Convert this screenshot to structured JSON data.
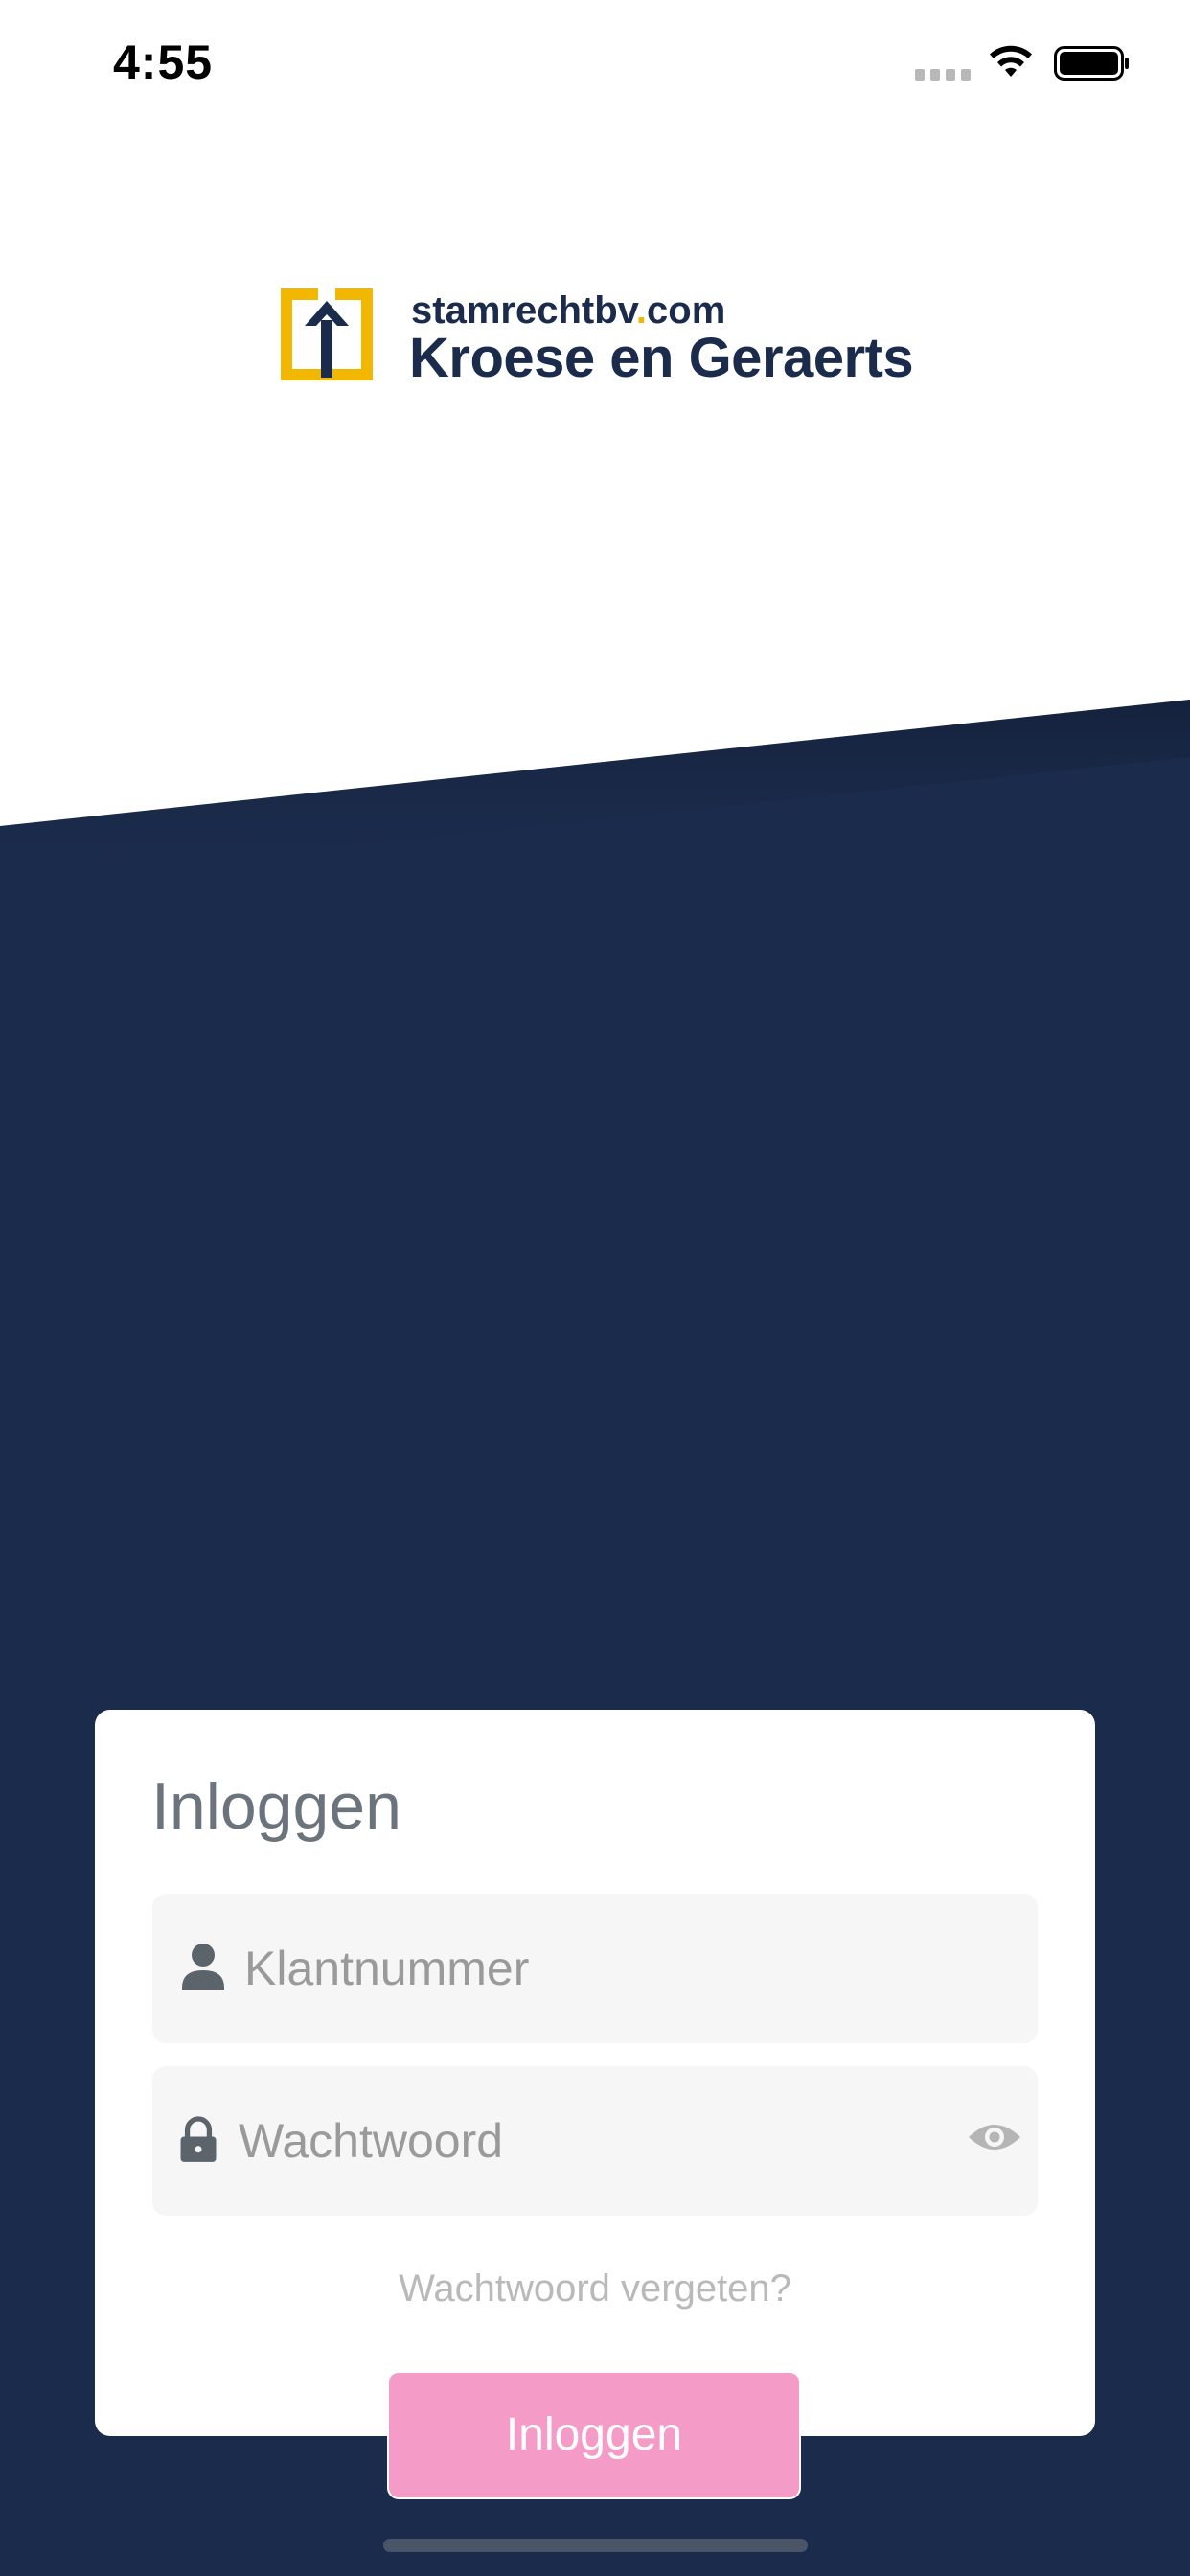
{
  "status_bar": {
    "time": "4:55"
  },
  "logo": {
    "domain_prefix": "stamrechtbv",
    "domain_dot": ".",
    "domain_suffix": "com",
    "company": "Kroese en Geraerts",
    "brand_color": "#f2b700"
  },
  "login": {
    "title": "Inloggen",
    "username_placeholder": "Klantnummer",
    "password_placeholder": "Wachtwoord",
    "forgot_label": "Wachtwoord vergeten?",
    "submit_label": "Inloggen"
  },
  "colors": {
    "navy": "#1b2b4b",
    "accent_pink": "#f49bc8",
    "yellow": "#f2b700"
  },
  "icons": {
    "username": "user-icon",
    "password": "lock-icon",
    "reveal": "eye-icon"
  }
}
